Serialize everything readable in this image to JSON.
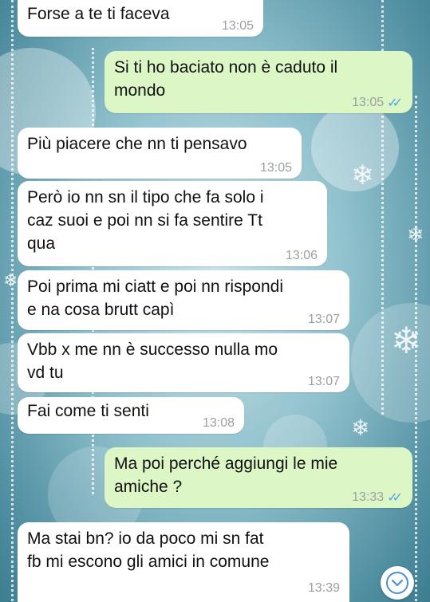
{
  "messages": [
    {
      "text": "Forse a te ti faceva",
      "time": "13:05",
      "direction": "incoming"
    },
    {
      "text": "Si ti ho baciato non è caduto il\nmondo",
      "time": "13:05",
      "direction": "outgoing",
      "read": true
    },
    {
      "text": "Più piacere che nn ti pensavo",
      "time": "13:05",
      "direction": "incoming"
    },
    {
      "text": "Però io nn sn il tipo che fa solo i\ncaz suoi e poi nn si fa sentire Tt\nqua",
      "time": "13:06",
      "direction": "incoming"
    },
    {
      "text": "Poi prima mi ciatt e poi nn rispondi\ne na cosa brutt capì",
      "time": "13:07",
      "direction": "incoming"
    },
    {
      "text": "Vbb x me nn è successo nulla mo\nvd tu",
      "time": "13:07",
      "direction": "incoming"
    },
    {
      "text": "Fai come ti senti",
      "time": "13:08",
      "direction": "incoming"
    },
    {
      "text": "Ma poi perché aggiungi le mie\namiche ?",
      "time": "13:33",
      "direction": "outgoing",
      "read": true
    },
    {
      "text": "Ma stai bn?  io da poco mi sn fat\nfb mi escono gli amici in comune",
      "time": "13:39",
      "direction": "incoming"
    }
  ],
  "colors": {
    "incoming": "#ffffff",
    "outgoing": "#dcf6c5",
    "read_ticks": "#4fa5e8",
    "timestamp": "#9aa0a3"
  },
  "icons": {
    "read_receipt": "double-check-icon",
    "scroll_down": "chevron-down-icon"
  }
}
